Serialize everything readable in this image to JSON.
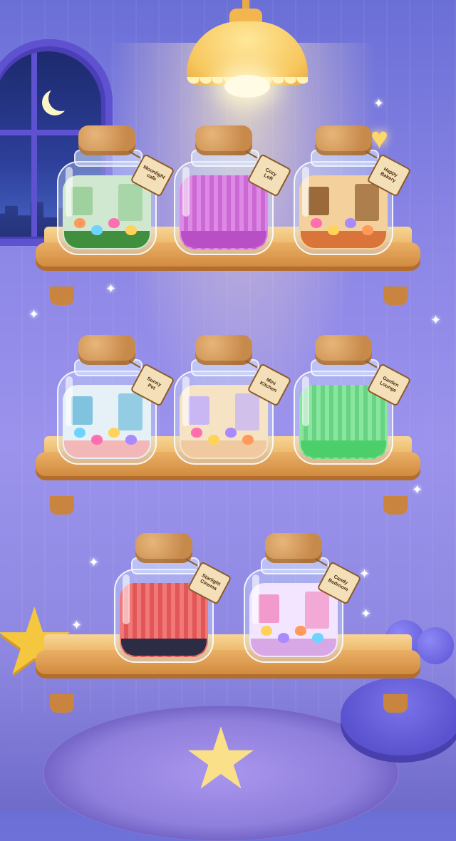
{
  "scene": "jar-shelf-collection",
  "colors": {
    "wall": "#8c86e6",
    "shelf_wood": "#ebb868",
    "cork": "#c78a4b",
    "tag": "#f4e0b8"
  },
  "shelves": [
    {
      "jars": [
        {
          "tag": "Moonlight\ncafe",
          "fill": "#cfe8cf",
          "floor": "#3f8f3f",
          "style": "room",
          "accent": "#9fd19f",
          "unlocked": true
        },
        {
          "tag": "Cozy\nLoft",
          "fill": "#d86fe0",
          "floor": "#b94fc6",
          "style": "curtain",
          "accent": "#e99bf0",
          "unlocked": false
        },
        {
          "tag": "Happy\nBakery",
          "fill": "#f3d09c",
          "floor": "#d9743b",
          "style": "room",
          "accent": "#9b6a3a",
          "unlocked": true
        }
      ]
    },
    {
      "jars": [
        {
          "tag": "Sunny\nPet",
          "fill": "#e6f1f7",
          "floor": "#f4b7b7",
          "style": "room",
          "accent": "#7fc3df",
          "unlocked": true
        },
        {
          "tag": "Mini\nKitchen",
          "fill": "#f6e3c4",
          "floor": "#f0c9a0",
          "style": "room",
          "accent": "#c8b7f2",
          "unlocked": true
        },
        {
          "tag": "Garden\nLounge",
          "fill": "#6fe08a",
          "floor": "#4ccf6b",
          "style": "curtain",
          "accent": "#9cf0ad",
          "unlocked": false
        }
      ]
    },
    {
      "jars": [
        {
          "tag": "Starlight\nCinema",
          "fill": "#ef5b5b",
          "floor": "#2c2c44",
          "style": "curtain",
          "accent": "#f58484",
          "unlocked": false
        },
        {
          "tag": "Candy\nBedroom",
          "fill": "#f3e4ff",
          "floor": "#d8a8e6",
          "style": "room",
          "accent": "#f29acb",
          "unlocked": true
        }
      ]
    }
  ]
}
